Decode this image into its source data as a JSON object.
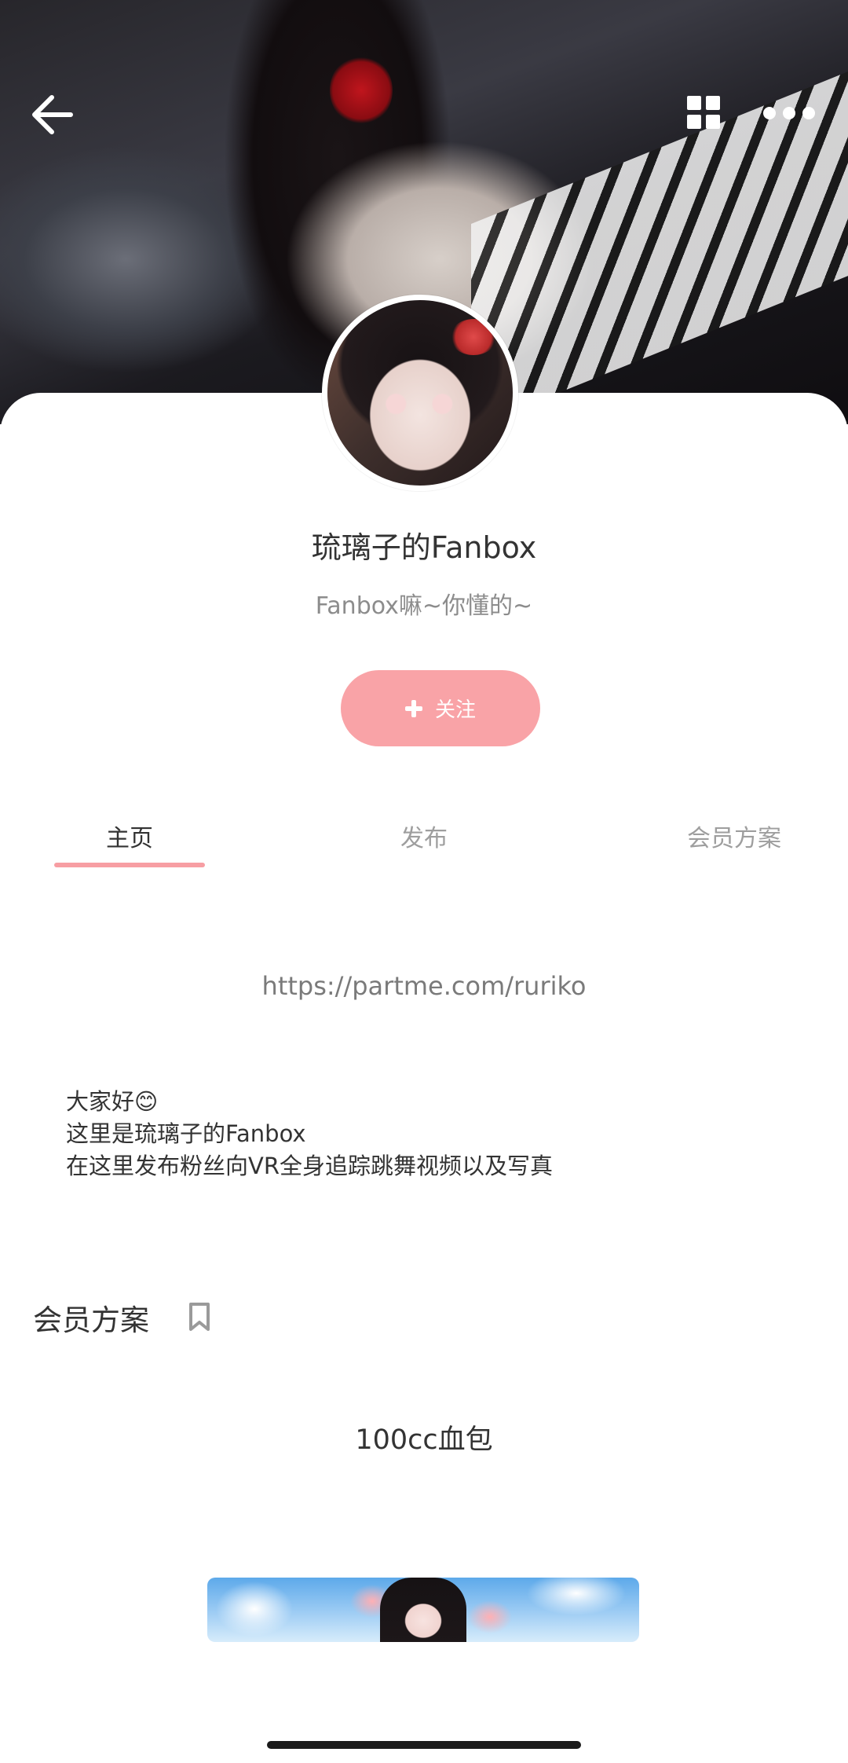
{
  "header": {
    "icons": [
      "back-arrow-icon",
      "grid-icon",
      "more-dots-icon"
    ]
  },
  "profile": {
    "name": "琉璃子的Fanbox",
    "tagline": "Fanbox嘛~你懂的~",
    "follow_label": "关注"
  },
  "tabs": [
    {
      "label": "主页",
      "active": true
    },
    {
      "label": "发布",
      "active": false
    },
    {
      "label": "会员方案",
      "active": false
    }
  ],
  "home": {
    "link": "https://partme.com/ruriko",
    "intro": [
      "大家好😊",
      "这里是琉璃子的Fanbox",
      "在这里发布粉丝向VR全身追踪跳舞视频以及写真"
    ]
  },
  "plans_section": {
    "title": "会员方案",
    "plan_name": "100cc血包"
  },
  "colors": {
    "accent": "#f9a3a7",
    "tab_underline": "#f79ea3",
    "muted_text": "#9e9e9e"
  }
}
